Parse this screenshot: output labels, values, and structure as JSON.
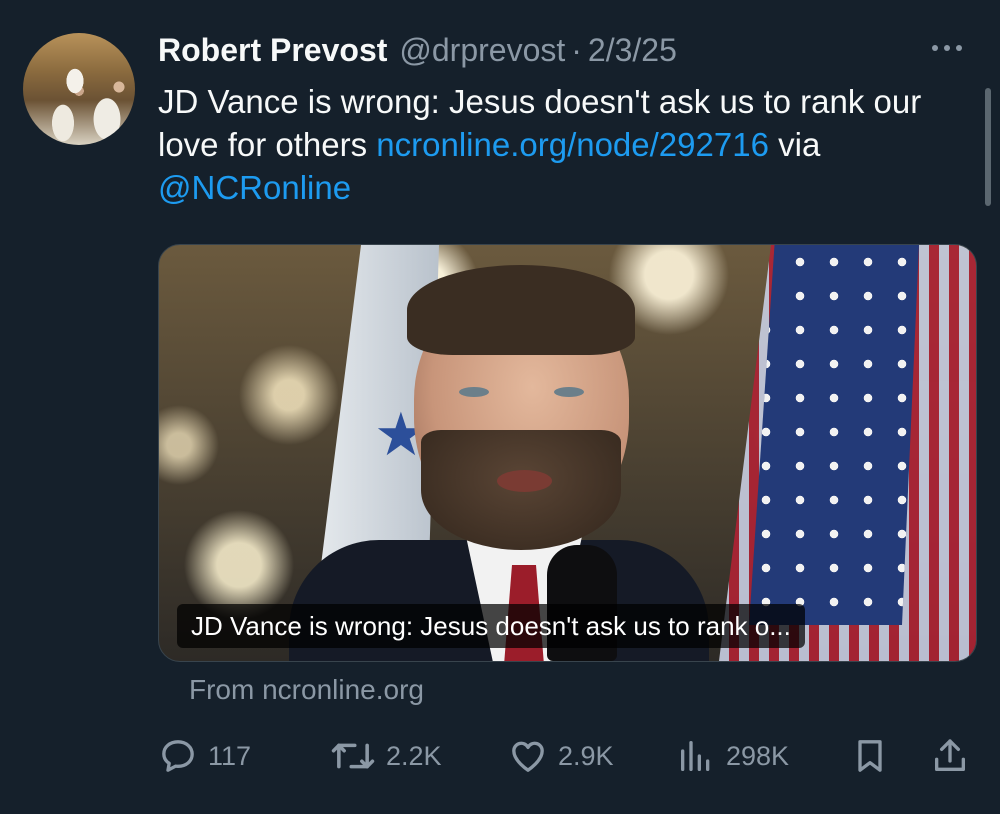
{
  "tweet": {
    "author_name": "Robert Prevost",
    "author_handle": "@drprevost",
    "separator": "·",
    "date": "2/3/25",
    "text_before_link": "JD Vance is wrong: Jesus doesn't ask us to rank our love for others ",
    "link_text": "ncronline.org/node/292716",
    "text_between": " via ",
    "mention_text": "@NCRonline"
  },
  "card": {
    "caption": "JD Vance is wrong: Jesus doesn't ask us to rank o...",
    "source": "From ncronline.org"
  },
  "actions": {
    "replies": "117",
    "retweets": "2.2K",
    "likes": "2.9K",
    "views": "298K"
  },
  "icons": {
    "reply": "speech-bubble-icon",
    "retweet": "retweet-icon",
    "like": "heart-icon",
    "views": "bar-chart-icon",
    "bookmark": "bookmark-icon",
    "share": "share-upload-icon",
    "more": "more-dots-icon"
  },
  "colors": {
    "background": "#15202b",
    "text": "#f7f9f9",
    "secondary": "#8b98a5",
    "link": "#1d9bf0"
  }
}
